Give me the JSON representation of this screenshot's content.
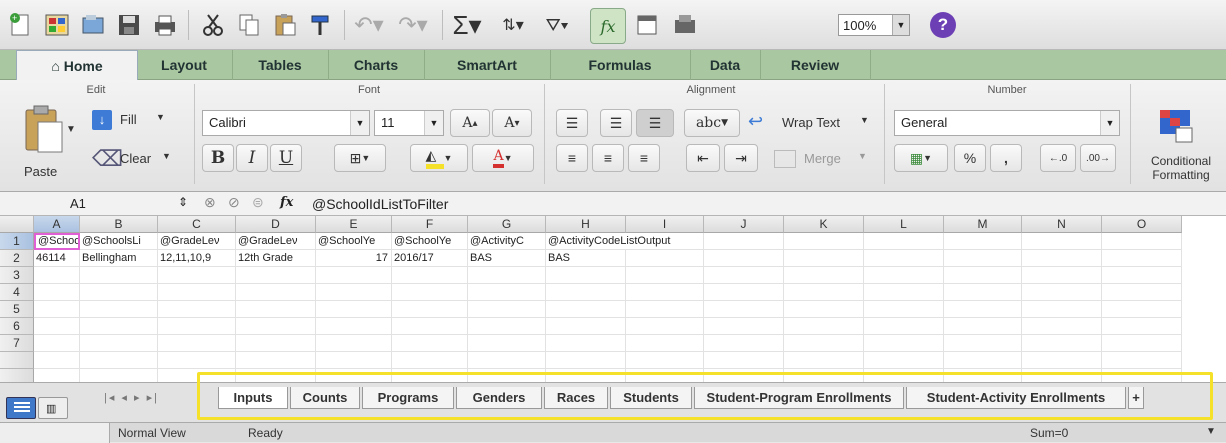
{
  "ribbon_tabs": [
    "Home",
    "Layout",
    "Tables",
    "Charts",
    "SmartArt",
    "Formulas",
    "Data",
    "Review"
  ],
  "zoom": "100%",
  "help_icon_text": "?",
  "groups": {
    "edit": "Edit",
    "font": "Font",
    "alignment": "Alignment",
    "number": "Number"
  },
  "edit": {
    "paste": "Paste",
    "fill": "Fill",
    "clear": "Clear"
  },
  "font": {
    "name": "Calibri",
    "size": "11",
    "bold": "B",
    "italic": "I",
    "underline": "U",
    "grow": "A",
    "shrink": "A",
    "fontcolor": "A"
  },
  "alignment": {
    "abc": "abc",
    "wrap": "Wrap Text",
    "merge": "Merge"
  },
  "number": {
    "format": "General",
    "percent": "%",
    "comma": ","
  },
  "conditional": {
    "line1": "Conditional",
    "line2": "Formatting"
  },
  "formula_bar": {
    "cell_ref": "A1",
    "fx": "fx",
    "content": "@SchoolIdListToFilter"
  },
  "columns": [
    "A",
    "B",
    "C",
    "D",
    "E",
    "F",
    "G",
    "H",
    "I",
    "J",
    "K",
    "L",
    "M",
    "N",
    "O"
  ],
  "rows": [
    "1",
    "2",
    "3",
    "4",
    "5",
    "6",
    "7"
  ],
  "row1": [
    "@SchoolId",
    "@SchoolsLi",
    "@GradeLeν",
    "@GradeLeν",
    "@SchoolYe",
    "@SchoolYe",
    "@ActivityC",
    "@ActivityCodeListOutput"
  ],
  "row2": [
    "46114",
    "Bellingham",
    "12,11,10,9",
    "12th Grade",
    "17",
    "2016/17",
    "BAS",
    "BAS"
  ],
  "sheet_tabs": [
    "Inputs",
    "Counts",
    "Programs",
    "Genders",
    "Races",
    "Students",
    "Student-Program Enrollments",
    "Student-Activity Enrollments"
  ],
  "status": {
    "view": "Normal View",
    "ready": "Ready",
    "sum": "Sum=0"
  },
  "colors": {
    "tab_bar": "#a9c7a1",
    "highlight": "#f5e12a",
    "active_cell": "#e05fd4"
  }
}
